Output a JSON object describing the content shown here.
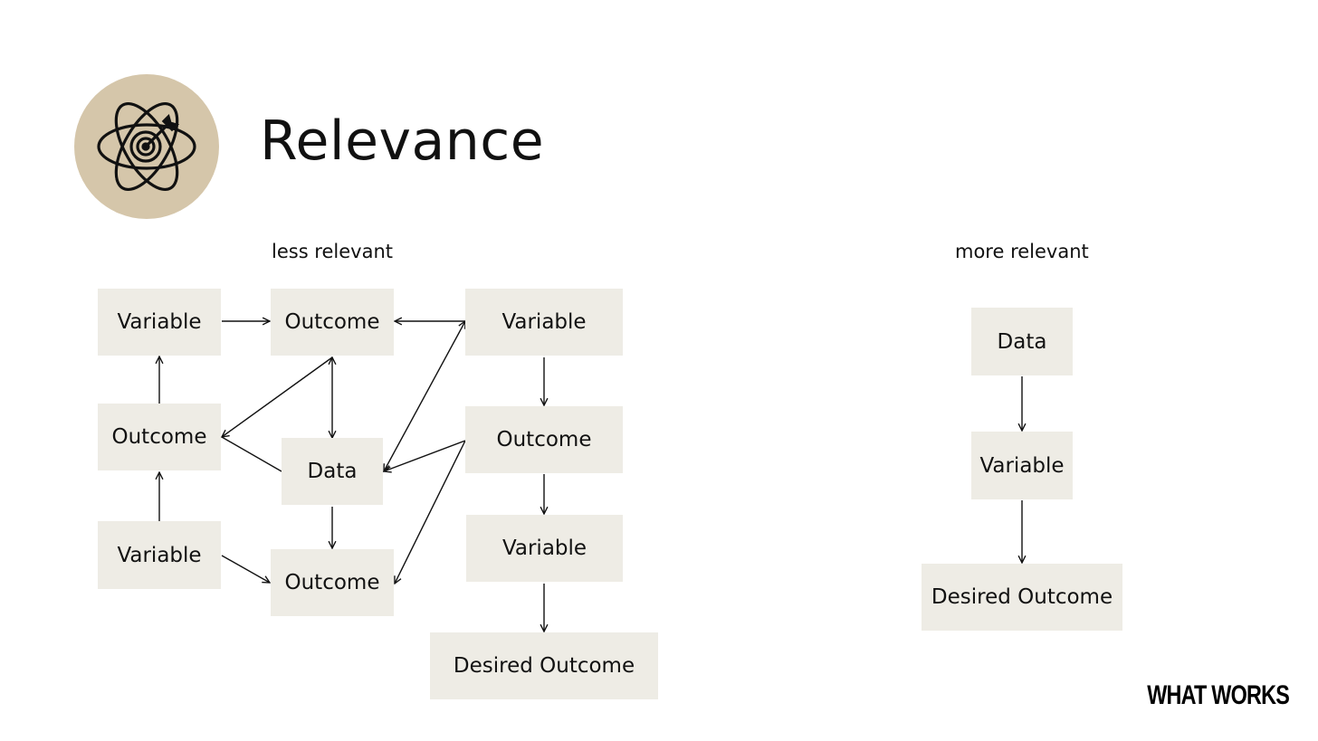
{
  "slide": {
    "title": "Relevance",
    "icon": "atom-target-icon",
    "accent_color": "#d5c6aa",
    "node_color": "#eeece5",
    "brand": "WHAT WORKS"
  },
  "less_relevant": {
    "label": "less relevant",
    "nodes": [
      {
        "id": "v1",
        "label": "Variable"
      },
      {
        "id": "o1",
        "label": "Outcome"
      },
      {
        "id": "v2",
        "label": "Variable"
      },
      {
        "id": "o2",
        "label": "Outcome"
      },
      {
        "id": "d1",
        "label": "Data"
      },
      {
        "id": "o3",
        "label": "Outcome"
      },
      {
        "id": "v3",
        "label": "Variable"
      },
      {
        "id": "o4",
        "label": "Outcome"
      },
      {
        "id": "v4",
        "label": "Variable"
      },
      {
        "id": "des1",
        "label": "Desired Outcome"
      }
    ],
    "edges": [
      {
        "from": "v1",
        "to": "o1",
        "type": "arrow"
      },
      {
        "from": "v2",
        "to": "o1",
        "type": "arrow"
      },
      {
        "from": "o2",
        "to": "v1",
        "type": "arrow"
      },
      {
        "from": "v3",
        "to": "o2",
        "type": "arrow"
      },
      {
        "from": "o1",
        "to": "d1",
        "type": "double-arrow"
      },
      {
        "from": "d1",
        "to": "o2",
        "type": "arrow"
      },
      {
        "from": "o1",
        "to": "o2",
        "type": "line"
      },
      {
        "from": "d1",
        "to": "o4",
        "type": "arrow"
      },
      {
        "from": "v3",
        "to": "o4",
        "type": "arrow"
      },
      {
        "from": "d1",
        "to": "v2",
        "type": "double-arrow"
      },
      {
        "from": "o3",
        "to": "d1",
        "type": "arrow"
      },
      {
        "from": "o3",
        "to": "o4",
        "type": "arrow"
      },
      {
        "from": "v2",
        "to": "o3",
        "type": "arrow"
      },
      {
        "from": "o3",
        "to": "v4",
        "type": "arrow"
      },
      {
        "from": "v4",
        "to": "des1",
        "type": "arrow"
      }
    ]
  },
  "more_relevant": {
    "label": "more relevant",
    "nodes": [
      {
        "id": "d2",
        "label": "Data"
      },
      {
        "id": "v5",
        "label": "Variable"
      },
      {
        "id": "des2",
        "label": "Desired Outcome"
      }
    ],
    "edges": [
      {
        "from": "d2",
        "to": "v5",
        "type": "arrow"
      },
      {
        "from": "v5",
        "to": "des2",
        "type": "arrow"
      }
    ]
  }
}
